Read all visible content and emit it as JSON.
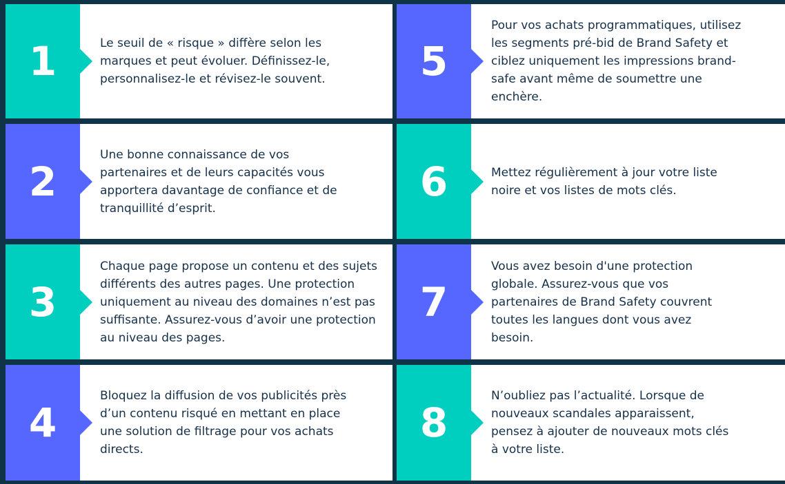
{
  "colors": {
    "background": "#0f3448",
    "teal": "#00cfc0",
    "blue": "#5567ff",
    "text": "#16304a"
  },
  "tips": [
    {
      "number": "1",
      "color": "teal",
      "text": "Le seuil de « risque » diffère selon les marques et peut évoluer. Définissez-le, personnalisez-le et révisez-le souvent."
    },
    {
      "number": "2",
      "color": "blue",
      "text": "Une bonne connaissance de vos partenaires et de leurs capacités vous apportera davantage de confiance et de tranquillité d’esprit."
    },
    {
      "number": "3",
      "color": "teal",
      "text": "Chaque page propose un contenu et des sujets différents des autres pages. Une protection uniquement au niveau des domaines n’est pas suffisante. Assurez-vous d’avoir une protection au niveau des pages."
    },
    {
      "number": "4",
      "color": "blue",
      "text": "Bloquez la diffusion de vos publicités près d’un contenu risqué en mettant en place une solution de filtrage pour vos achats directs."
    },
    {
      "number": "5",
      "color": "blue",
      "text": "Pour vos achats programmatiques, utilisez les segments pré-bid de Brand Safety et ciblez uniquement les impressions brand-safe avant même de soumettre une enchère."
    },
    {
      "number": "6",
      "color": "teal",
      "text": "Mettez régulièrement à jour votre liste noire et vos listes de mots clés."
    },
    {
      "number": "7",
      "color": "blue",
      "text": "Vous avez besoin d'une protection globale. Assurez-vous que vos partenaires de Brand Safety couvrent toutes les langues dont vous avez besoin."
    },
    {
      "number": "8",
      "color": "teal",
      "text": "N’oubliez pas l’actualité. Lorsque de nouveaux scandales apparaissent, pensez à ajouter de nouveaux mots clés à votre liste."
    }
  ]
}
